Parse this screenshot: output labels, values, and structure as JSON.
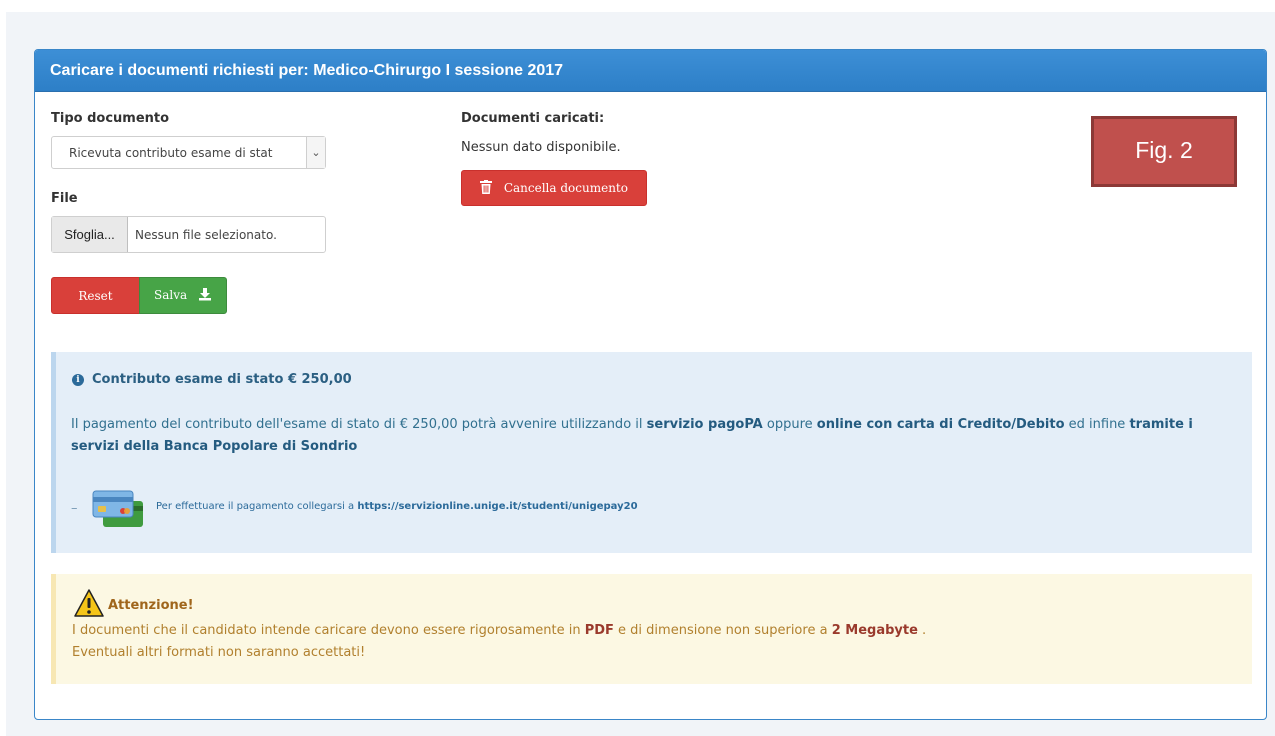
{
  "panel": {
    "title": "Caricare i documenti richiesti per: Medico-Chirurgo I sessione 2017"
  },
  "form": {
    "doc_type_label": "Tipo documento",
    "doc_type_value": "Ricevuta contributo esame di stat",
    "file_label": "File",
    "browse_label": "Sfoglia...",
    "file_status": "Nessun file selezionato.",
    "reset_label": "Reset",
    "save_label": "Salva",
    "save_icon": "download-icon"
  },
  "documents": {
    "title": "Documenti caricati:",
    "empty_text": "Nessun dato disponibile.",
    "delete_label": "Cancella documento",
    "delete_icon": "trash-icon"
  },
  "figure_label": "Fig. 2",
  "info": {
    "title": "Contributo esame di stato € 250,00",
    "para_part1": "Il pagamento del contributo dell'esame di stato di € 250,00 potrà avvenire utilizzando il ",
    "para_bold1": "servizio pagoPA",
    "para_part2": " oppure ",
    "para_bold2": "online con carta di Credito/Debito",
    "para_part3": " ed infine ",
    "para_bold3": "tramite i servizi della Banca Popolare di Sondrio",
    "dash": "–",
    "payment_text": "Per effettuare il pagamento collegarsi a ",
    "payment_link": "https://servizionline.unige.it/studenti/unigepay20"
  },
  "warning": {
    "title": "Attenzione!",
    "line1_part1": "I documenti che il candidato intende caricare devono essere rigorosamente in ",
    "line1_bold1": "PDF",
    "line1_part2": " e di dimensione non superiore a ",
    "line1_bold2": "2 Megabyte",
    "line1_part3": " .",
    "line2": "Eventuali altri formati non saranno accettati!"
  },
  "colors": {
    "header_blue": "#2d7fc7",
    "danger": "#d9403a",
    "success": "#47a447",
    "info_bg": "#e4eef8",
    "warning_bg": "#fcf8e3",
    "fig_red": "#c0504d"
  }
}
